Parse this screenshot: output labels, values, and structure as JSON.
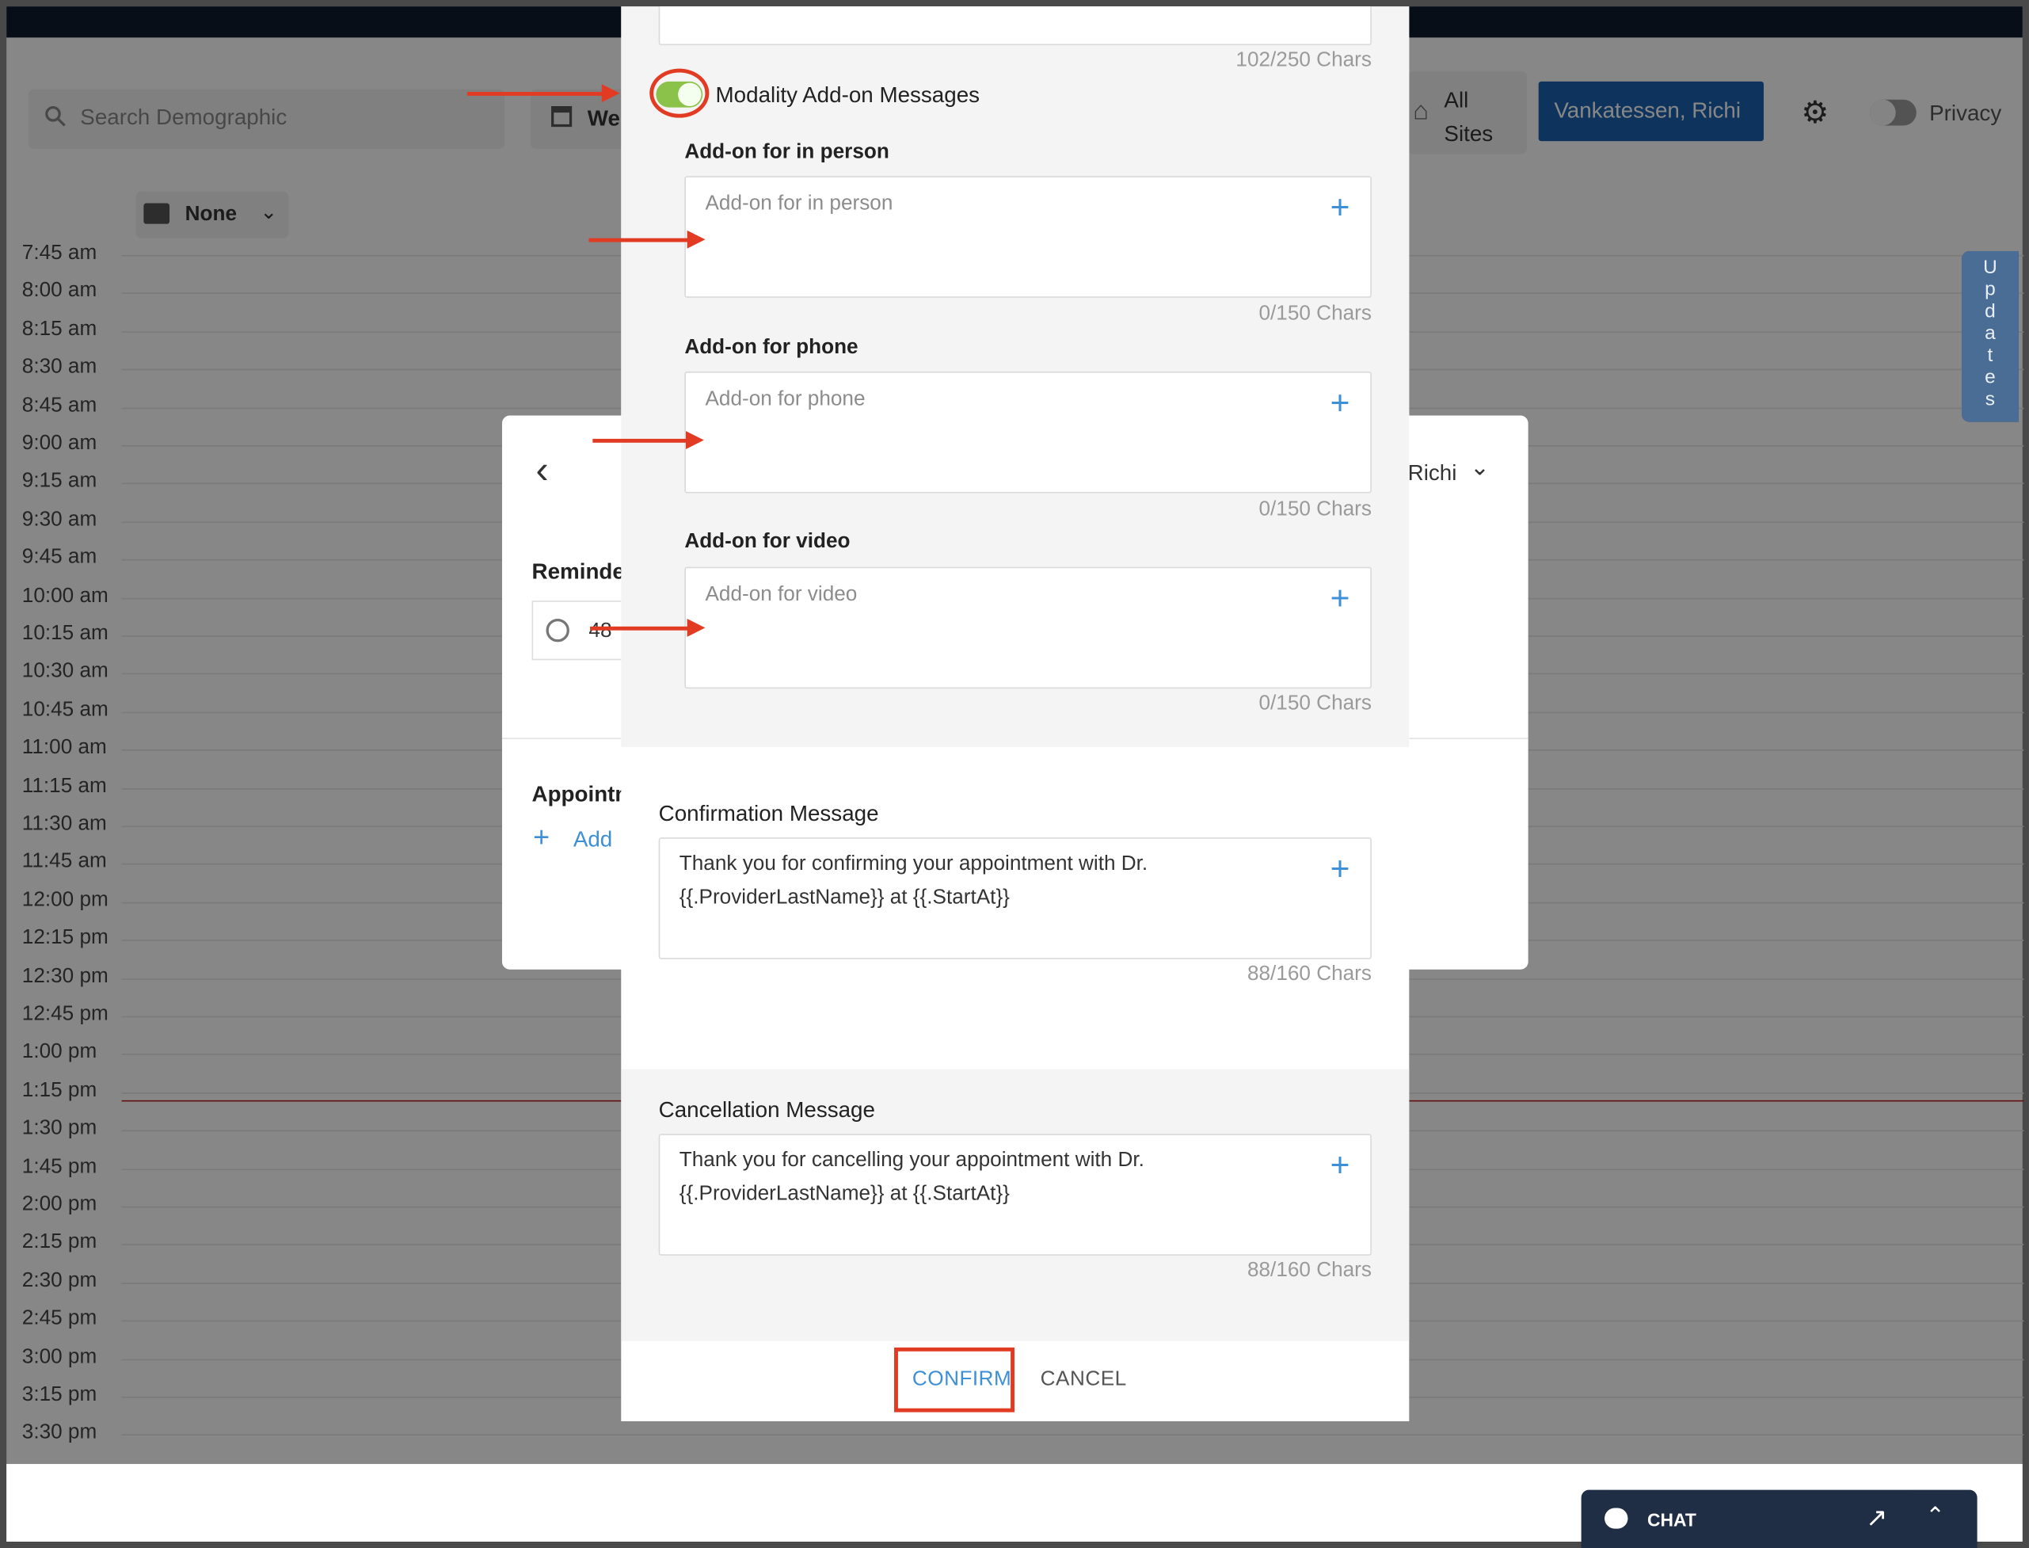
{
  "background": {
    "search_placeholder": "Search Demographic",
    "week_button": "We",
    "all_sites": "All Sites",
    "user_button": "Vankatessen, Richi",
    "privacy_label": "Privacy",
    "filter_label": "None",
    "updates_tab": "Updates",
    "times": [
      "7:45 am",
      "8:00 am",
      "8:15 am",
      "8:30 am",
      "8:45 am",
      "9:00 am",
      "9:15 am",
      "9:30 am",
      "9:45 am",
      "10:00 am",
      "10:15 am",
      "10:30 am",
      "10:45 am",
      "11:00 am",
      "11:15 am",
      "11:30 am",
      "11:45 am",
      "12:00 pm",
      "12:15 pm",
      "12:30 pm",
      "12:45 pm",
      "1:00 pm",
      "1:15 pm",
      "1:30 pm",
      "1:45 pm",
      "2:00 pm",
      "2:15 pm",
      "2:30 pm",
      "2:45 pm",
      "3:00 pm",
      "3:15 pm",
      "3:30 pm"
    ]
  },
  "mid_dialog": {
    "reminder_label": "Reminde",
    "reminder_value": "48",
    "provider_fragment": "Richi",
    "appointment_label": "Appointm",
    "add_label": "Add"
  },
  "dialog": {
    "top_counter": "102/250 Chars",
    "modality_toggle_label": "Modality Add-on Messages",
    "modality_toggle_on": true,
    "addons": [
      {
        "label": "Add-on for in person",
        "placeholder": "Add-on for in person",
        "counter": "0/150 Chars"
      },
      {
        "label": "Add-on for phone",
        "placeholder": "Add-on for phone",
        "counter": "0/150 Chars"
      },
      {
        "label": "Add-on for video",
        "placeholder": "Add-on for video",
        "counter": "0/150 Chars"
      }
    ],
    "confirmation": {
      "label": "Confirmation Message",
      "line1": "Thank you for confirming your appointment with Dr.",
      "line2": "{{.ProviderLastName}} at {{.StartAt}}",
      "counter": "88/160 Chars"
    },
    "cancellation": {
      "label": "Cancellation Message",
      "line1": "Thank you for cancelling your appointment with Dr.",
      "line2": "{{.ProviderLastName}} at {{.StartAt}}",
      "counter": "88/160 Chars"
    },
    "confirm_button": "CONFIRM",
    "cancel_button": "CANCEL"
  },
  "chat": {
    "label": "CHAT"
  },
  "colors": {
    "accent": "#3d8fd6",
    "toggle_on": "#8bc34a",
    "annotation": "#e23b23",
    "navy": "#0f1b2e"
  }
}
